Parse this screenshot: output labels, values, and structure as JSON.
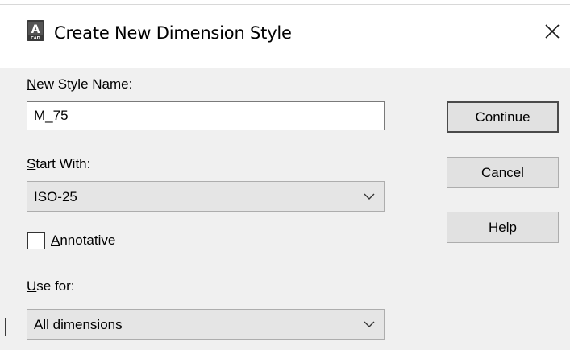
{
  "window": {
    "title": "Create New Dimension Style",
    "app_icon": "autocad-icon",
    "app_icon_letter": "A",
    "app_icon_caption": "CAD",
    "close_glyph": "✕"
  },
  "new_style": {
    "label_key": "N",
    "label_rest": "ew Style Name:",
    "value": "M_75"
  },
  "start_with": {
    "label_key": "S",
    "label_rest": "tart With:",
    "selected": "ISO-25"
  },
  "annotative": {
    "label_key": "A",
    "label_rest": "nnotative",
    "checked": false
  },
  "use_for": {
    "label_key": "U",
    "label_rest": "se for:",
    "selected": "All dimensions"
  },
  "buttons": {
    "continue": "Continue",
    "cancel": "Cancel",
    "help_key": "H",
    "help_rest": "elp"
  },
  "colors": {
    "dialog_bg": "#f0f0f0",
    "titlebar_bg": "#ffffff",
    "button_bg": "#e1e1e1",
    "default_button_border": "#4a4a4a"
  }
}
